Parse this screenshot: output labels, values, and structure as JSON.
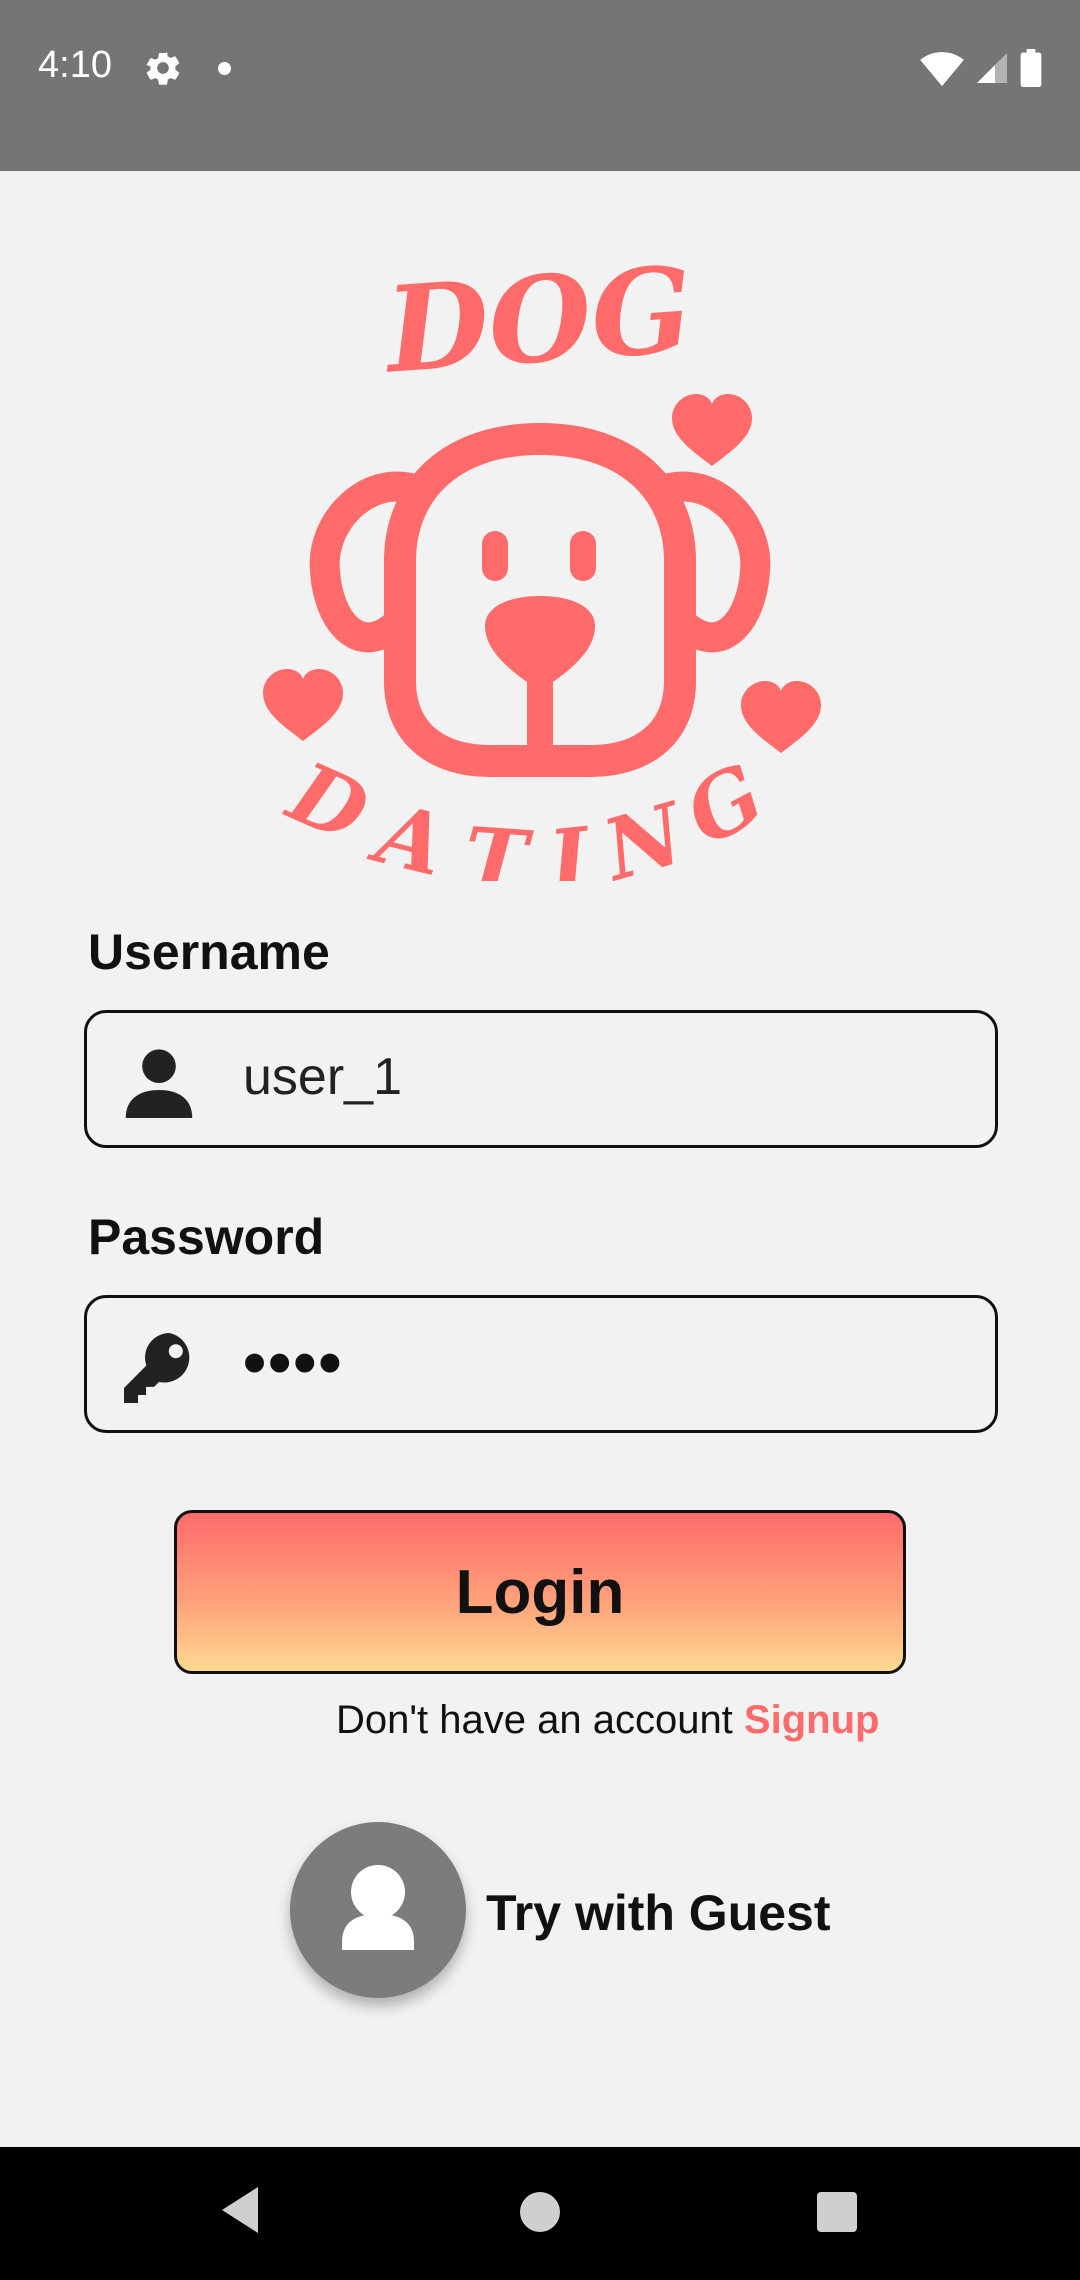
{
  "status_bar": {
    "time": "4:10",
    "icons": [
      "gear-icon",
      "notification-dot-icon",
      "wifi-icon",
      "signal-icon",
      "battery-icon"
    ]
  },
  "logo": {
    "top_text": "DOG",
    "bottom_text": "DATING",
    "color": "#ff6b6b"
  },
  "form": {
    "username_label": "Username",
    "username_value": "user_1",
    "username_icon": "person-icon",
    "password_label": "Password",
    "password_value": "••••",
    "password_icon": "key-icon"
  },
  "login": {
    "button_label": "Login",
    "gradient_top": "#ff6b6b",
    "gradient_bottom": "#ffd991"
  },
  "signup": {
    "prompt": "Don't have an account",
    "link": "Signup"
  },
  "guest": {
    "label": "Try with Guest",
    "icon": "person-icon"
  },
  "nav_bar": {
    "icons": [
      "back-icon",
      "home-icon",
      "recents-icon"
    ]
  }
}
